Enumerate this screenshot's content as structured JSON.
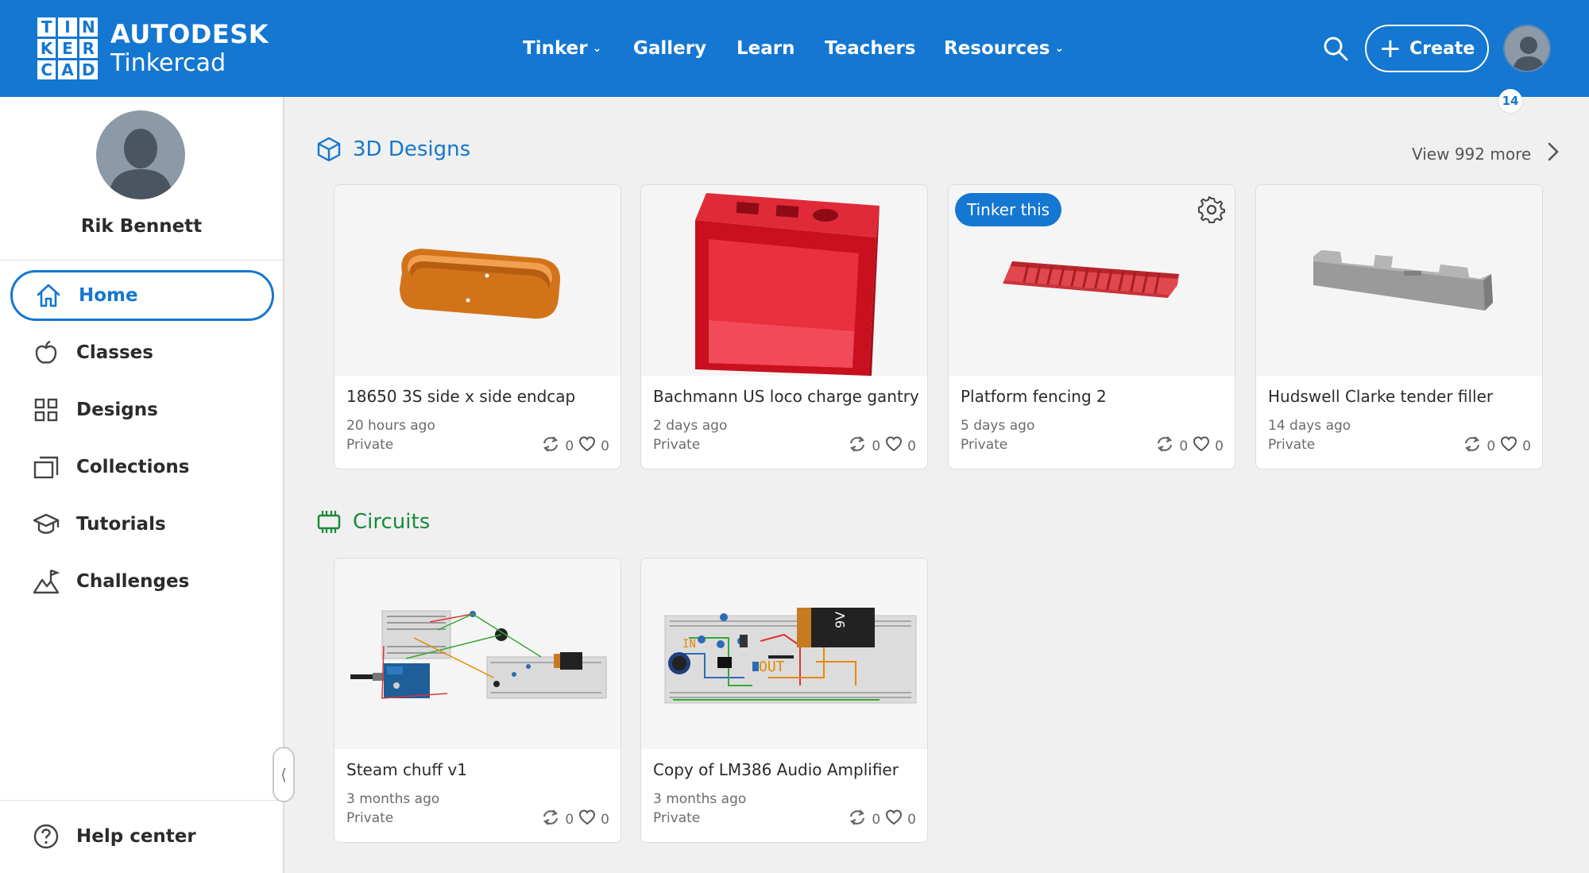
{
  "header": {
    "logo_letters": [
      "T",
      "I",
      "N",
      "K",
      "E",
      "R",
      "C",
      "A",
      "D"
    ],
    "brand_top": "AUTODESK",
    "brand_bottom": "Tinkercad",
    "nav": [
      {
        "label": "Tinker",
        "dropdown": true
      },
      {
        "label": "Gallery",
        "dropdown": false
      },
      {
        "label": "Learn",
        "dropdown": false
      },
      {
        "label": "Teachers",
        "dropdown": false
      },
      {
        "label": "Resources",
        "dropdown": true
      }
    ],
    "create_label": "Create",
    "notification_count": "14",
    "accent_color": "#1477d1"
  },
  "sidebar": {
    "user_name": "Rik Bennett",
    "items": [
      {
        "label": "Home",
        "icon": "home-icon",
        "active": true
      },
      {
        "label": "Classes",
        "icon": "apple-icon",
        "active": false
      },
      {
        "label": "Designs",
        "icon": "grid-icon",
        "active": false
      },
      {
        "label": "Collections",
        "icon": "collections-icon",
        "active": false
      },
      {
        "label": "Tutorials",
        "icon": "graduation-cap-icon",
        "active": false
      },
      {
        "label": "Challenges",
        "icon": "mountain-flag-icon",
        "active": false
      }
    ],
    "help_label": "Help center"
  },
  "designs_section": {
    "title": "3D Designs",
    "view_more": "View 992 more",
    "title_color": "#1477d1",
    "cards": [
      {
        "title": "18650 3S side x side endcap",
        "time": "20 hours ago",
        "privacy": "Private",
        "remixes": "0",
        "likes": "0"
      },
      {
        "title": "Bachmann US loco charge gantry",
        "time": "2 days ago",
        "privacy": "Private",
        "remixes": "0",
        "likes": "0"
      },
      {
        "title": "Platform fencing 2",
        "time": "5 days ago",
        "privacy": "Private",
        "remixes": "0",
        "likes": "0",
        "badge": "Tinker this"
      },
      {
        "title": "Hudswell Clarke tender filler",
        "time": "14 days ago",
        "privacy": "Private",
        "remixes": "0",
        "likes": "0"
      }
    ]
  },
  "circuits_section": {
    "title": "Circuits",
    "title_color": "#1a8a3a",
    "cards": [
      {
        "title": "Steam chuff v1",
        "time": "3 months ago",
        "privacy": "Private",
        "remixes": "0",
        "likes": "0"
      },
      {
        "title": "Copy of LM386 Audio Amplifier",
        "time": "3 months ago",
        "privacy": "Private",
        "remixes": "0",
        "likes": "0"
      }
    ]
  },
  "thumb_labels": {
    "battery": "9V",
    "in": "IN",
    "out": "OUT"
  }
}
